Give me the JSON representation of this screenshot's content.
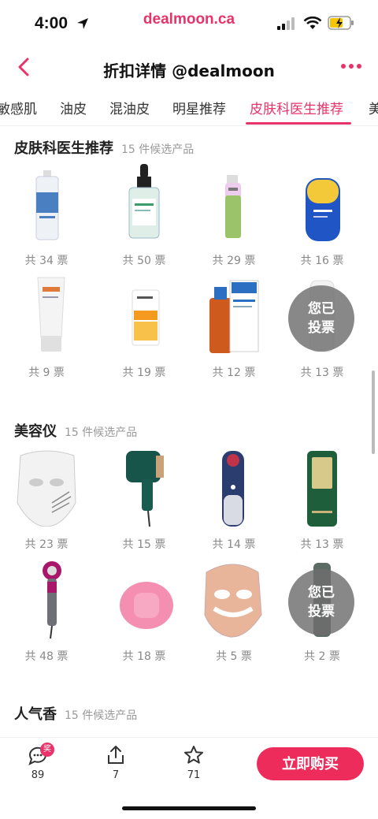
{
  "status": {
    "time": "4:00",
    "url": "dealmoon.ca"
  },
  "nav": {
    "title": "折扣详情 @dealmoon"
  },
  "tabs": [
    "敏感肌",
    "油皮",
    "混油皮",
    "明星推荐",
    "皮肤科医生推荐",
    "美"
  ],
  "active_tab_index": 4,
  "sections": [
    {
      "title": "皮肤科医生推荐",
      "subtitle": "15 件候选产品",
      "products": [
        {
          "votes": "共 34 票",
          "icon": "spray-bottle-icon"
        },
        {
          "votes": "共 50 票",
          "icon": "serum-dropper-icon"
        },
        {
          "votes": "共 29 票",
          "icon": "pump-bottle-icon"
        },
        {
          "votes": "共 16 票",
          "icon": "sunscreen-bottle-icon"
        },
        {
          "votes": "共 9 票",
          "icon": "cream-tube-icon"
        },
        {
          "votes": "共 19 票",
          "icon": "sunscreen-tube-icon"
        },
        {
          "votes": "共 12 票",
          "icon": "shampoo-bottle-icon"
        },
        {
          "votes": "共 13 票",
          "icon": "lotion-bottle-icon",
          "voted": true
        }
      ]
    },
    {
      "title": "美容仪",
      "subtitle": "15 件候选产品",
      "products": [
        {
          "votes": "共 23 票",
          "icon": "led-mask-icon"
        },
        {
          "votes": "共 15 票",
          "icon": "hair-removal-device-icon"
        },
        {
          "votes": "共 14 票",
          "icon": "facial-device-icon"
        },
        {
          "votes": "共 13 票",
          "icon": "ipl-device-icon"
        },
        {
          "votes": "共 48 票",
          "icon": "hair-dryer-icon"
        },
        {
          "votes": "共 18 票",
          "icon": "cleansing-brush-icon"
        },
        {
          "votes": "共 5 票",
          "icon": "face-mask-device-icon"
        },
        {
          "votes": "共 2 票",
          "icon": "handheld-device-icon",
          "voted": true
        }
      ]
    },
    {
      "title": "人气香",
      "subtitle": "15 件候选产品"
    }
  ],
  "voted_label": [
    "您已",
    "投票"
  ],
  "bottom_bar": {
    "comments": "89",
    "award_badge": "奖",
    "shares": "7",
    "favorites": "71",
    "buy_label": "立即购买"
  },
  "colors": {
    "accent": "#e8336a",
    "buy_button": "#ee2c5c"
  }
}
